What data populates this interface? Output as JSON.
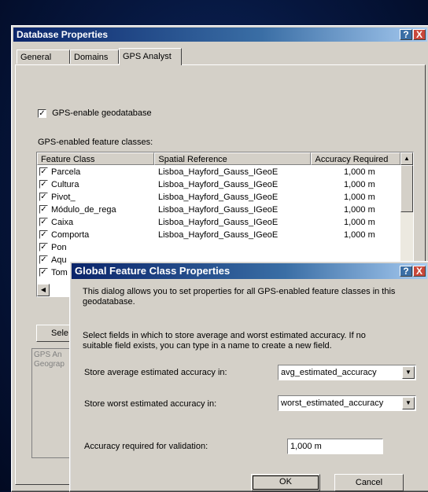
{
  "db_window": {
    "title": "Database Properties",
    "help_glyph": "?",
    "close_glyph": "X",
    "tabs": [
      {
        "label": "General"
      },
      {
        "label": "Domains"
      },
      {
        "label": "GPS Analyst"
      }
    ],
    "gps_enable": {
      "checked": true,
      "check_glyph": "✓",
      "label": "GPS-enable geodatabase"
    },
    "classes_label": "GPS-enabled feature classes:",
    "columns": [
      "Feature Class",
      "Spatial Reference",
      "Accuracy Required"
    ],
    "rows": [
      {
        "name": "Parcela",
        "sr": "Lisboa_Hayford_Gauss_IGeoE",
        "acc": "1,000 m"
      },
      {
        "name": "Cultura",
        "sr": "Lisboa_Hayford_Gauss_IGeoE",
        "acc": "1,000 m"
      },
      {
        "name": "Pivot_",
        "sr": "Lisboa_Hayford_Gauss_IGeoE",
        "acc": "1,000 m"
      },
      {
        "name": "Módulo_de_rega",
        "sr": "Lisboa_Hayford_Gauss_IGeoE",
        "acc": "1,000 m"
      },
      {
        "name": "Caixa",
        "sr": "Lisboa_Hayford_Gauss_IGeoE",
        "acc": "1,000 m"
      },
      {
        "name": "Comporta",
        "sr": "Lisboa_Hayford_Gauss_IGeoE",
        "acc": "1,000 m"
      },
      {
        "name": "Pon",
        "sr": "",
        "acc": ""
      },
      {
        "name": "Aqu",
        "sr": "",
        "acc": ""
      },
      {
        "name": "Tom",
        "sr": "",
        "acc": ""
      }
    ],
    "select_button": "Sele",
    "info_lines": [
      "GPS An",
      "Geograp"
    ]
  },
  "global_dialog": {
    "title": "Global Feature Class Properties",
    "help_glyph": "?",
    "close_glyph": "X",
    "intro_line1": "This dialog allows you to set properties for all GPS-enabled feature classes in this",
    "intro_line2": "geodatabase.",
    "fields_line1": "Select fields in which to store average and worst estimated accuracy. If no",
    "fields_line2": "suitable field exists, you can type in a name to create a new field.",
    "avg_label": "Store average estimated accuracy in:",
    "avg_value": "avg_estimated_accuracy",
    "worst_label": "Store worst estimated accuracy in:",
    "worst_value": "worst_estimated_accuracy",
    "validation_label": "Accuracy required for validation:",
    "validation_value": "1,000 m",
    "ok_label": "OK",
    "cancel_label": "Cancel"
  }
}
